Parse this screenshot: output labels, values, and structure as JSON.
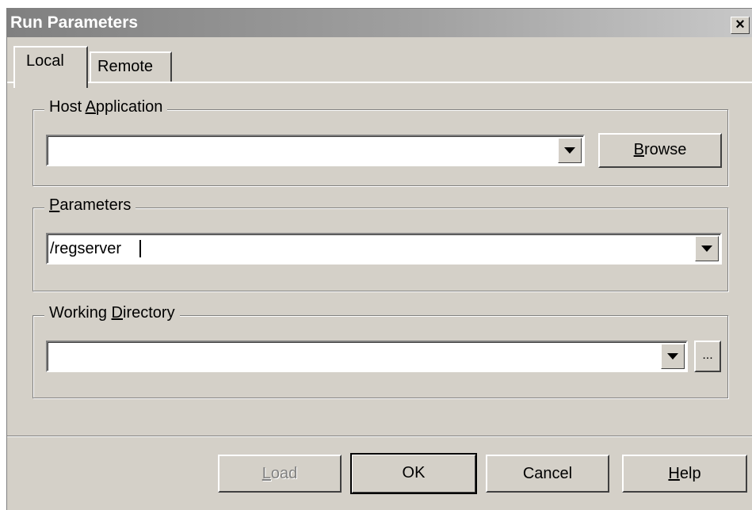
{
  "window": {
    "title": "Run Parameters",
    "close_label": "×"
  },
  "tabs": [
    {
      "label": "Local",
      "selected": true
    },
    {
      "label": "Remote",
      "selected": false
    }
  ],
  "host_application": {
    "label_pre": "Host ",
    "label_accel": "A",
    "label_post": "pplication",
    "value": "",
    "browse_accel": "B",
    "browse_rest": "rowse"
  },
  "parameters": {
    "label_accel": "P",
    "label_post": "arameters",
    "value": "/regserver"
  },
  "working_directory": {
    "label_pre": "Working ",
    "label_accel": "D",
    "label_post": "irectory",
    "value": "",
    "browse_label": "..."
  },
  "buttons": {
    "load_accel": "L",
    "load_rest": "oad",
    "ok": "OK",
    "cancel": "Cancel",
    "help_accel": "H",
    "help_rest": "elp"
  },
  "icons": {
    "dropdown": "triangle-down-icon",
    "close": "close-icon"
  }
}
